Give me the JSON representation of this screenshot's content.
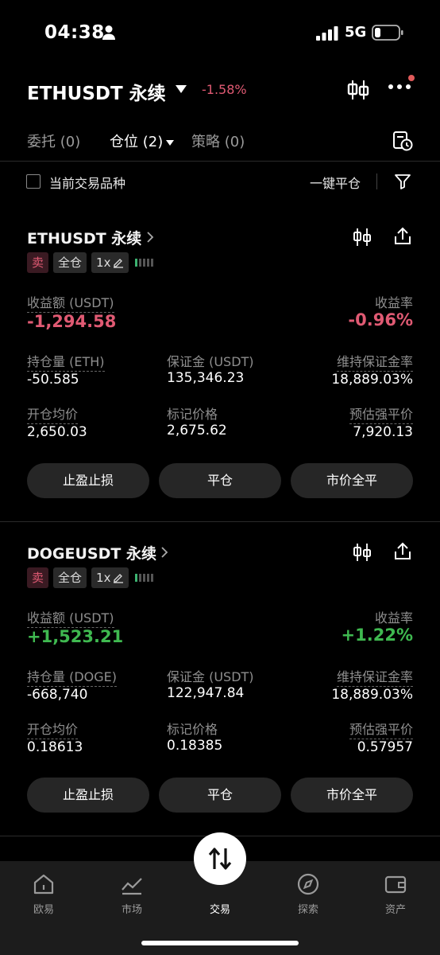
{
  "status_bar": {
    "time": "04:38",
    "network": "5G"
  },
  "header": {
    "symbol": "ETHUSDT 永续",
    "change": "-1.58%"
  },
  "tabs": [
    {
      "label": "委托 (0)"
    },
    {
      "label": "仓位 (2)"
    },
    {
      "label": "策略 (0)"
    }
  ],
  "filter": {
    "checkbox_label": "当前交易品种",
    "close_all": "一键平仓"
  },
  "positions": [
    {
      "name": "ETHUSDT 永续",
      "side": "卖",
      "margin_mode": "全仓",
      "leverage": "1x",
      "pnl_label": "收益额 (USDT)",
      "pnl": "-1,294.58",
      "roe_label": "收益率",
      "roe": "-0.96%",
      "size_label": "持仓量 (ETH)",
      "size": "-50.585",
      "margin_label": "保证金 (USDT)",
      "margin": "135,346.23",
      "mmr_label": "维持保证金率",
      "mmr": "18,889.03%",
      "entry_label": "开仓均价",
      "entry": "2,650.03",
      "mark_label": "标记价格",
      "mark": "2,675.62",
      "liq_label": "预估强平价",
      "liq": "7,920.13",
      "btn_tpsl": "止盈止损",
      "btn_close": "平仓",
      "btn_market_close": "市价全平"
    },
    {
      "name": "DOGEUSDT 永续",
      "side": "卖",
      "margin_mode": "全仓",
      "leverage": "1x",
      "pnl_label": "收益额 (USDT)",
      "pnl": "+1,523.21",
      "roe_label": "收益率",
      "roe": "+1.22%",
      "size_label": "持仓量 (DOGE)",
      "size": "-668,740",
      "margin_label": "保证金 (USDT)",
      "margin": "122,947.84",
      "mmr_label": "维持保证金率",
      "mmr": "18,889.03%",
      "entry_label": "开仓均价",
      "entry": "0.18613",
      "mark_label": "标记价格",
      "mark": "0.18385",
      "liq_label": "预估强平价",
      "liq": "0.57957",
      "btn_tpsl": "止盈止损",
      "btn_close": "平仓",
      "btn_market_close": "市价全平"
    }
  ],
  "bottom_nav": [
    {
      "label": "欧易",
      "icon": "home-icon"
    },
    {
      "label": "市场",
      "icon": "market-chart-icon"
    },
    {
      "label": "交易",
      "icon": "trade-swap-icon"
    },
    {
      "label": "探索",
      "icon": "compass-icon"
    },
    {
      "label": "资产",
      "icon": "wallet-icon"
    }
  ],
  "colors": {
    "negative": "#e05a73",
    "positive": "#3fb950",
    "background": "#000000"
  }
}
